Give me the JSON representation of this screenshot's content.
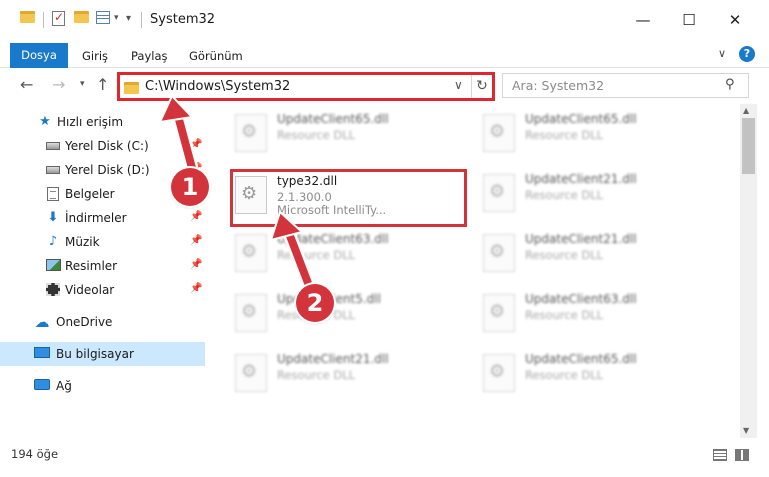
{
  "window": {
    "title": "System32",
    "minimize_glyph": "—",
    "maximize_glyph": "☐",
    "close_glyph": "✕"
  },
  "ribbon": {
    "tabs": [
      {
        "label": "Dosya"
      },
      {
        "label": "Giriş"
      },
      {
        "label": "Paylaş"
      },
      {
        "label": "Görünüm"
      }
    ]
  },
  "nav": {
    "address": "C:\\Windows\\System32",
    "search_placeholder": "Ara: System32"
  },
  "sidebar": {
    "items": [
      {
        "label": "Hızlı erişim",
        "icon": "star-icon"
      },
      {
        "label": "Yerel Disk (C:)",
        "icon": "drive-icon"
      },
      {
        "label": "Yerel Disk (D:)",
        "icon": "drive-icon"
      },
      {
        "label": "Belgeler",
        "icon": "documents-icon"
      },
      {
        "label": "İndirmeler",
        "icon": "download-icon"
      },
      {
        "label": "Müzik",
        "icon": "music-icon"
      },
      {
        "label": "Resimler",
        "icon": "pictures-icon"
      },
      {
        "label": "Videolar",
        "icon": "videos-icon"
      },
      {
        "label": "OneDrive",
        "icon": "cloud-icon"
      },
      {
        "label": "Bu bilgisayar",
        "icon": "computer-icon"
      },
      {
        "label": "Ağ",
        "icon": "network-icon"
      }
    ]
  },
  "files": {
    "col1": [
      {
        "name": "UpdateClient65.dll",
        "sub": "Resource DLL"
      },
      {
        "name": "UpdateClient63.dll",
        "sub": "Resource DLL"
      },
      {
        "name": "UpdateClient5.dll",
        "sub": "Resource DLL"
      },
      {
        "name": "UpdateClient21.dll",
        "sub": "Resource DLL"
      }
    ],
    "col2": [
      {
        "name": "UpdateClient65.dll",
        "sub": "Resource DLL"
      },
      {
        "name": "UpdateClient21.dll",
        "sub": "Resource DLL"
      },
      {
        "name": "UpdateClient21.dll",
        "sub": "Resource DLL"
      },
      {
        "name": "UpdateClient63.dll",
        "sub": "Resource DLL"
      },
      {
        "name": "UpdateClient65.dll",
        "sub": "Resource DLL"
      }
    ],
    "highlighted": {
      "name": "type32.dll",
      "version": "2.1.300.0",
      "company": "Microsoft IntelliTy..."
    }
  },
  "status": {
    "count": "194 öğe"
  },
  "callouts": {
    "one": "1",
    "two": "2",
    "color": "#d3343b"
  }
}
